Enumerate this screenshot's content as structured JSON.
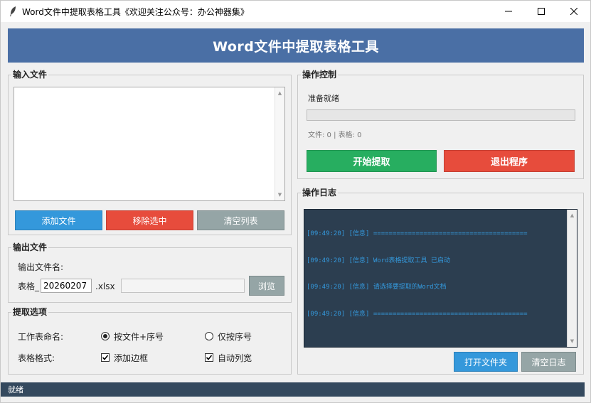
{
  "window": {
    "title": "Word文件中提取表格工具《欢迎关注公众号：办公神器集》",
    "icon": "feather-icon"
  },
  "header": {
    "title": "Word文件中提取表格工具"
  },
  "input_files": {
    "group_label": "输入文件",
    "files": [],
    "buttons": {
      "add": "添加文件",
      "remove": "移除选中",
      "clear": "清空列表"
    }
  },
  "output_file": {
    "group_label": "输出文件",
    "name_label": "输出文件名:",
    "prefix": "表格_",
    "name_value": "20260207",
    "extension": ".xlsx",
    "path_value": "",
    "browse_label": "浏览"
  },
  "extract_options": {
    "group_label": "提取选项",
    "sheet_name_label": "工作表命名:",
    "sheet_name_options": [
      {
        "label": "按文件+序号",
        "checked": true
      },
      {
        "label": "仅按序号",
        "checked": false
      }
    ],
    "table_format_label": "表格格式:",
    "table_format_options": [
      {
        "label": "添加边框",
        "checked": true
      },
      {
        "label": "自动列宽",
        "checked": true
      }
    ]
  },
  "controls": {
    "group_label": "操作控制",
    "status_text": "准备就绪",
    "progress": 0,
    "stats_text": "文件: 0 | 表格: 0",
    "start_label": "开始提取",
    "exit_label": "退出程序"
  },
  "log": {
    "group_label": "操作日志",
    "lines": [
      "[09:49:20] [信息] ========================================",
      "[09:49:20] [信息] Word表格提取工具 已启动",
      "[09:49:20] [信息] 请选择要提取的Word文档",
      "[09:49:20] [信息] ========================================"
    ],
    "open_folder_label": "打开文件夹",
    "clear_log_label": "清空日志"
  },
  "statusbar": {
    "text": "就绪"
  },
  "colors": {
    "header_bg": "#4a6fa5",
    "blue_button": "#3498db",
    "red_button": "#e74c3c",
    "gray_button": "#95a5a6",
    "green_button": "#27ae60",
    "log_bg": "#2c3e50",
    "log_text": "#3498db",
    "statusbar_bg": "#34495e"
  }
}
